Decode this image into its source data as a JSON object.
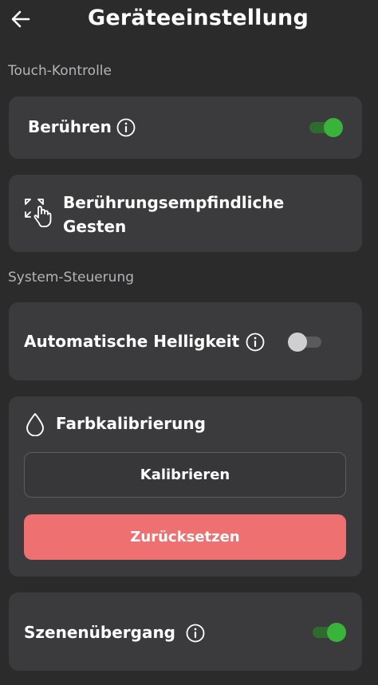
{
  "header": {
    "title": "Geräteeinstellung",
    "back_icon": "arrow-left-icon"
  },
  "sections": {
    "touch": "Touch-Kontrolle",
    "system": "System-Steuerung"
  },
  "touch_card": {
    "label": "Berühren",
    "toggle_on": true
  },
  "gestures_card": {
    "label_line1": "Berührungsempfindliche",
    "label_line2": "Gesten",
    "icon": "gesture-hand-icon"
  },
  "brightness_card": {
    "label": "Automatische Helligkeit",
    "toggle_on": false
  },
  "calibration_card": {
    "title": "Farbkalibrierung",
    "icon": "droplet-icon",
    "calibrate_label": "Kalibrieren",
    "reset_label": "Zurücksetzen"
  },
  "scene_card": {
    "label": "Szenenübergang",
    "toggle_on": true
  },
  "colors": {
    "accent_green": "#39b43a",
    "reset_red": "#ee7070",
    "card_bg": "#3b3b3d",
    "bg": "#2b2b2c"
  }
}
